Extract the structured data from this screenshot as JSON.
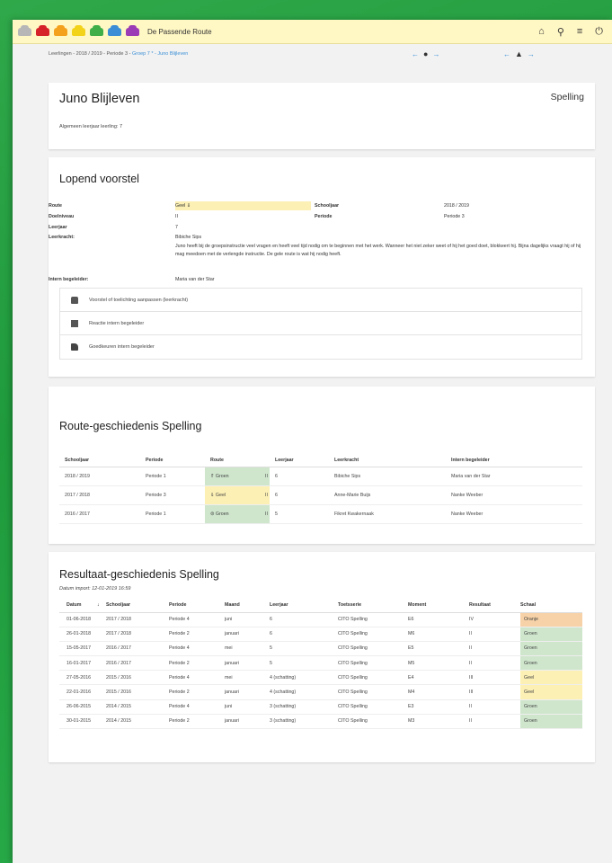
{
  "app": {
    "title": "De Passende Route",
    "route_cars": [
      {
        "icon": "grey-car-icon",
        "color": "#b7b7b7"
      },
      {
        "icon": "red-car-icon",
        "color": "#d6232a"
      },
      {
        "icon": "orange-car-icon",
        "color": "#f4a21e"
      },
      {
        "icon": "yellow-car-icon",
        "color": "#f3d21a"
      },
      {
        "icon": "green-car-icon",
        "color": "#3fae49"
      },
      {
        "icon": "blue-car-icon",
        "color": "#3b8ed6"
      },
      {
        "icon": "purple-car-icon",
        "color": "#9b3bb5"
      }
    ],
    "top_icons": [
      "home-icon",
      "lightbulb-icon",
      "menu-icon",
      "power-icon"
    ]
  },
  "breadcrumb": {
    "base": "Leerlingen - 2018 / 2019 - Periode 3 - ",
    "link": "Groep 7 * - Juno Blijleven"
  },
  "student": {
    "name": "Juno Blijleven",
    "subject": "Spelling",
    "info": "Algemeen leerjaar leerling: 7"
  },
  "proposal": {
    "title": "Lopend voorstel",
    "labels": {
      "route": "Route",
      "doelniveau": "Doelniveau",
      "leerjaar": "Leerjaar",
      "leerkracht": "Leerkracht:",
      "schooljaar": "Schooljaar",
      "periode": "Periode",
      "intern": "Intern begeleider:"
    },
    "values": {
      "route": "Geel ⇓",
      "doelniveau": "II",
      "leerjaar": "7",
      "leerkracht_name": "Bibiche Sips",
      "leerkracht_note": "Juno heeft bij de groepsinstructie veel vragen en heeft veel tijd nodig om te beginnen met het werk. Wanneer het niet zeker weet of hij het goed doet, blokkeert hij. Bijna dagelijks vraagt hij of hij mag meedoen met de verlengde instructie. De gele route is wat hij nodig heeft.",
      "schooljaar": "2018 / 2019",
      "periode": "Periode 3",
      "intern": "Maria van der Star"
    },
    "actions": [
      {
        "label": "Voorstel of toelichting aanpassen (leerkracht)",
        "icon": "car-front-icon"
      },
      {
        "label": "Reactie intern begeleider",
        "icon": "comment-icon"
      },
      {
        "label": "Goedkeuren intern begeleider",
        "icon": "thumbs-up-icon"
      }
    ]
  },
  "route_history": {
    "title": "Route-geschiedenis Spelling",
    "headers": [
      "Schooljaar",
      "Periode",
      "Route",
      "Leerjaar",
      "Leerkracht",
      "Intern begeleider"
    ],
    "rows": [
      {
        "schooljaar": "2018 / 2019",
        "periode": "Periode 1",
        "route": "⇑ Groen",
        "route_suffix": "II",
        "route_color": "green",
        "leerjaar": "6",
        "leerkracht": "Bibiche Sips",
        "intern": "Maria van der Star"
      },
      {
        "schooljaar": "2017 / 2018",
        "periode": "Periode 3",
        "route": "⇓ Geel",
        "route_suffix": "II",
        "route_color": "yellow",
        "leerjaar": "6",
        "leerkracht": "Anne-Marie Buijs",
        "intern": "Nanke Weeber"
      },
      {
        "schooljaar": "2016 / 2017",
        "periode": "Periode 1",
        "route": "⊜ Groen",
        "route_suffix": "II",
        "route_color": "green",
        "leerjaar": "5",
        "leerkracht": "Fikret Kwakernaak",
        "intern": "Nanke Weeber"
      }
    ]
  },
  "result_history": {
    "title": "Resultaat-geschiedenis Spelling",
    "import_label": "Datum import: 12-01-2019 16:59",
    "sort_indicator": "↓",
    "headers": [
      "Datum",
      "Schooljaar",
      "Periode",
      "Maand",
      "Leerjaar",
      "Toetsserie",
      "Moment",
      "Resultaat",
      "Schaal"
    ],
    "rows": [
      {
        "datum": "01-06-2018",
        "schooljaar": "2017 / 2018",
        "periode": "Periode 4",
        "maand": "juni",
        "leerjaar": "6",
        "toetsserie": "CITO Spelling",
        "moment": "E6",
        "resultaat": "IV",
        "schaal": "Oranje",
        "color": "orange"
      },
      {
        "datum": "26-01-2018",
        "schooljaar": "2017 / 2018",
        "periode": "Periode 2",
        "maand": "januari",
        "leerjaar": "6",
        "toetsserie": "CITO Spelling",
        "moment": "M6",
        "resultaat": "II",
        "schaal": "Groen",
        "color": "green"
      },
      {
        "datum": "15-05-2017",
        "schooljaar": "2016 / 2017",
        "periode": "Periode 4",
        "maand": "mei",
        "leerjaar": "5",
        "toetsserie": "CITO Spelling",
        "moment": "E5",
        "resultaat": "II",
        "schaal": "Groen",
        "color": "green"
      },
      {
        "datum": "16-01-2017",
        "schooljaar": "2016 / 2017",
        "periode": "Periode 2",
        "maand": "januari",
        "leerjaar": "5",
        "toetsserie": "CITO Spelling",
        "moment": "M5",
        "resultaat": "II",
        "schaal": "Groen",
        "color": "green"
      },
      {
        "datum": "27-05-2016",
        "schooljaar": "2015 / 2016",
        "periode": "Periode 4",
        "maand": "mei",
        "leerjaar": "4 (schatting)",
        "toetsserie": "CITO Spelling",
        "moment": "E4",
        "resultaat": "III",
        "schaal": "Geel",
        "color": "yellow"
      },
      {
        "datum": "22-01-2016",
        "schooljaar": "2015 / 2016",
        "periode": "Periode 2",
        "maand": "januari",
        "leerjaar": "4 (schatting)",
        "toetsserie": "CITO Spelling",
        "moment": "M4",
        "resultaat": "III",
        "schaal": "Geel",
        "color": "yellow"
      },
      {
        "datum": "26-06-2015",
        "schooljaar": "2014 / 2015",
        "periode": "Periode 4",
        "maand": "juni",
        "leerjaar": "3 (schatting)",
        "toetsserie": "CITO Spelling",
        "moment": "E3",
        "resultaat": "II",
        "schaal": "Groen",
        "color": "green"
      },
      {
        "datum": "30-01-2015",
        "schooljaar": "2014 / 2015",
        "periode": "Periode 2",
        "maand": "januari",
        "leerjaar": "3 (schatting)",
        "toetsserie": "CITO Spelling",
        "moment": "M3",
        "resultaat": "II",
        "schaal": "Groen",
        "color": "green"
      }
    ]
  }
}
